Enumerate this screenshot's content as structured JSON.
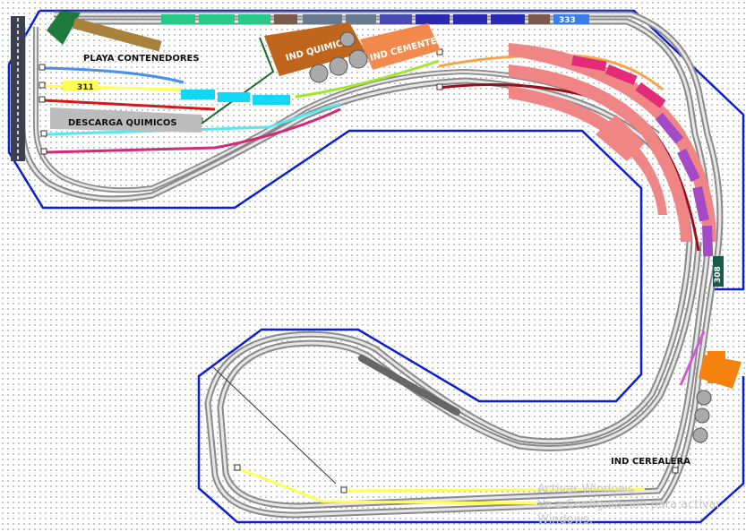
{
  "labels": {
    "playa_contenedores": "PLAYA CONTENEDORES",
    "descarga_quimicos": "DESCARGA QUIMICOS",
    "ind_quimica": "IND QUIMICA",
    "ind_cementera": "IND CEMENTERA",
    "ind_cerealera": "IND CEREALERA",
    "loco_311": "311",
    "loco_333": "333",
    "loco_308": "308"
  },
  "watermark": {
    "line1": "Activar Windows",
    "line2": "Ve a Configuración para activar Windows."
  },
  "colors": {
    "board_outline": "#0a1fd6",
    "track_outer": "#8a8a8a",
    "track_inner": "#e6e6e6",
    "quimica_building": "#c0651c",
    "cementera_building": "#f28a4e",
    "cerealera_building": "#f5820f",
    "platform_pink": "#f08585",
    "siding_blue": "#4a8ef0",
    "siding_yellow": "#ffff55",
    "siding_teal": "#55e8f0",
    "siding_magenta": "#d12a7a",
    "siding_darkred": "#9a0f1c",
    "siding_green": "#9ee82a",
    "siding_purple": "#d35ad3",
    "siding_orange": "#f2a64a",
    "train_blue_wagons": "#2a2ab0",
    "train_green_wagons": "#27c98a",
    "train_grey_wagons": "#6a7a8e",
    "train_pink_wagons": "#e32b7a",
    "train_purple_wagons": "#a54ac7",
    "train_cyan_wagons": "#12d8f5"
  }
}
